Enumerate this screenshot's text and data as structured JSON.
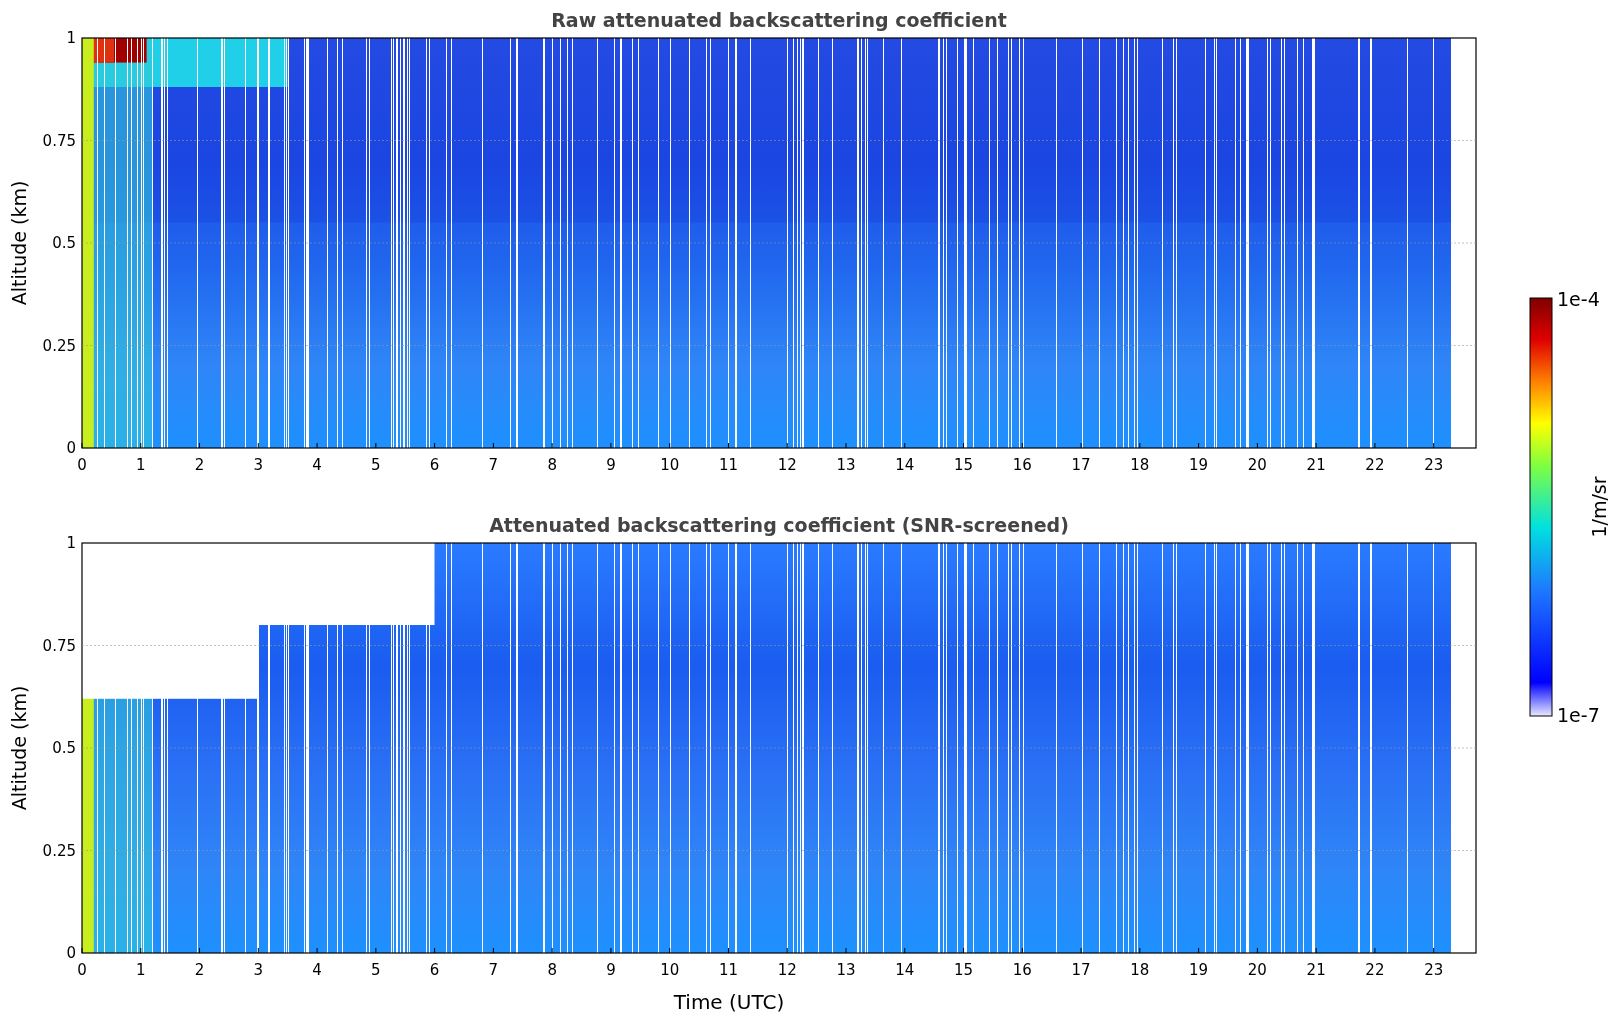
{
  "plots": [
    {
      "title": "Raw attenuated backscattering coefficient",
      "ylabel": "Altitude (km)",
      "yticks": [
        "1",
        "0.75",
        "0.5",
        "0.25",
        "0"
      ],
      "xticks": [
        "0",
        "1",
        "2",
        "3",
        "4",
        "5",
        "6",
        "7",
        "8",
        "9",
        "10",
        "11",
        "12",
        "13",
        "14",
        "15",
        "16",
        "17",
        "18",
        "19",
        "20",
        "21",
        "22",
        "23"
      ],
      "kind": "raw"
    },
    {
      "title": "Attenuated backscattering coefficient (SNR-screened)",
      "ylabel": "Altitude (km)",
      "yticks": [
        "1",
        "0.75",
        "0.5",
        "0.25",
        "0"
      ],
      "xticks": [
        "0",
        "1",
        "2",
        "3",
        "4",
        "5",
        "6",
        "7",
        "8",
        "9",
        "10",
        "11",
        "12",
        "13",
        "14",
        "15",
        "16",
        "17",
        "18",
        "19",
        "20",
        "21",
        "22",
        "23"
      ],
      "xlabel": "Time (UTC)",
      "kind": "screened"
    }
  ],
  "colorbar": {
    "max_label": "1e-4",
    "min_label": "1e-7",
    "label": "1/m/sr"
  }
}
